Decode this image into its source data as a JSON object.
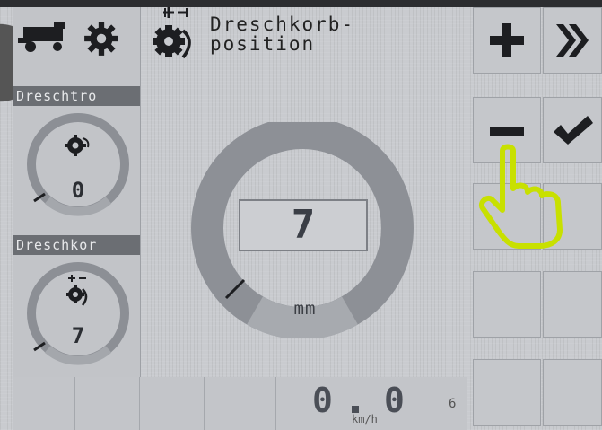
{
  "header": {
    "title_line1": "Dreschkorb-",
    "title_line2": "position",
    "title_icon": "concave-adjust-icon"
  },
  "left_panel": {
    "icons": [
      "combine-harvester-icon",
      "gear-icon"
    ],
    "panel1": {
      "label": "Dreschtro",
      "value": "0",
      "icon": "drum-speed-icon"
    },
    "panel2": {
      "label": "Dreschkor",
      "value": "7",
      "icon": "concave-adjust-icon"
    }
  },
  "main_gauge": {
    "value": "7",
    "unit": "mm",
    "level": 0.1
  },
  "softkeys": {
    "plus": "plus-icon",
    "forward": "double-chevron-right-icon",
    "minus": "minus-icon",
    "confirm": "check-icon"
  },
  "status_bar": {
    "speed_int": "0",
    "speed_dec": "0",
    "speed_unit": "km/h",
    "gear": "6"
  },
  "colors": {
    "display_bg": "#c9cbcf",
    "panel_header": "#6b6e73",
    "highlight": "#c8e000"
  }
}
